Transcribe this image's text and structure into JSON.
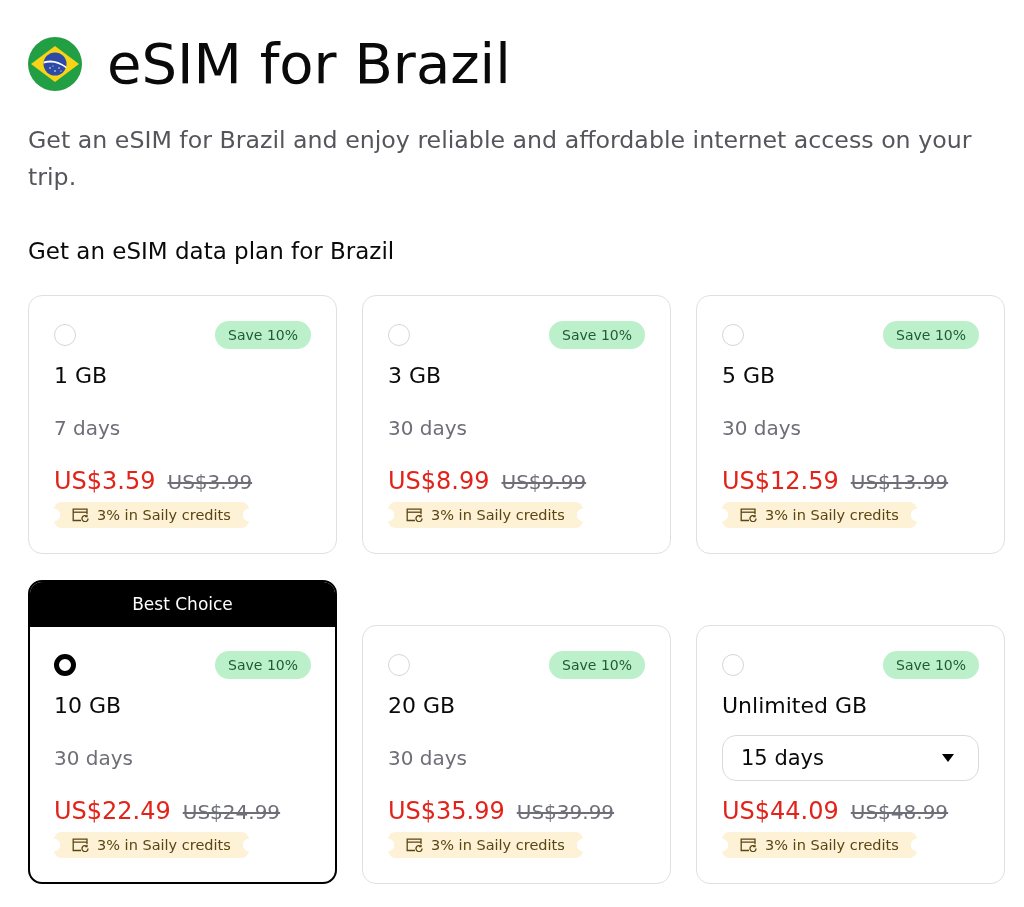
{
  "header": {
    "title": "eSIM for Brazil",
    "description": "Get an eSIM for Brazil and enjoy reliable and affordable internet access on your trip."
  },
  "plans_section": {
    "heading": "Get an eSIM data plan for Brazil",
    "plans": [
      {
        "kind": "fixed",
        "selected": false,
        "badge": "Save 10%",
        "data": "1 GB",
        "duration": "7 days",
        "price": "US$3.59",
        "original_price": "US$3.99",
        "credits": "3% in Saily credits"
      },
      {
        "kind": "fixed",
        "selected": false,
        "badge": "Save 10%",
        "data": "3 GB",
        "duration": "30 days",
        "price": "US$8.99",
        "original_price": "US$9.99",
        "credits": "3% in Saily credits"
      },
      {
        "kind": "fixed",
        "selected": false,
        "badge": "Save 10%",
        "data": "5 GB",
        "duration": "30 days",
        "price": "US$12.59",
        "original_price": "US$13.99",
        "credits": "3% in Saily credits"
      },
      {
        "kind": "fixed",
        "selected": true,
        "ribbon": "Best Choice",
        "badge": "Save 10%",
        "data": "10 GB",
        "duration": "30 days",
        "price": "US$22.49",
        "original_price": "US$24.99",
        "credits": "3% in Saily credits"
      },
      {
        "kind": "fixed",
        "selected": false,
        "badge": "Save 10%",
        "data": "20 GB",
        "duration": "30 days",
        "price": "US$35.99",
        "original_price": "US$39.99",
        "credits": "3% in Saily credits"
      },
      {
        "kind": "selectable",
        "selected": false,
        "badge": "Save 10%",
        "data": "Unlimited GB",
        "duration_select": {
          "value": "15 days"
        },
        "price": "US$44.09",
        "original_price": "US$48.99",
        "credits": "3% in Saily credits"
      }
    ]
  }
}
